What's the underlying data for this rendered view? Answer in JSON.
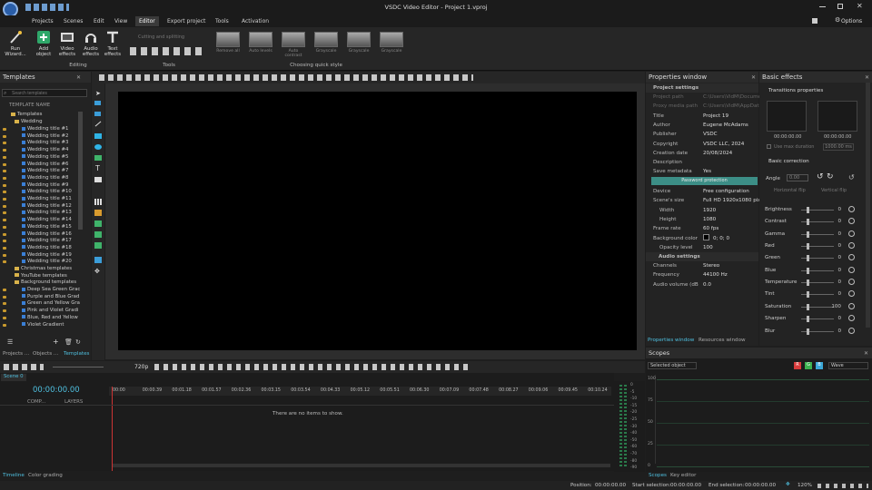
{
  "window": {
    "title": "VSDC Video Editor - Project 1.vproj",
    "options_label": "Options"
  },
  "menu": [
    {
      "label": "Projects"
    },
    {
      "label": "Scenes"
    },
    {
      "label": "Edit"
    },
    {
      "label": "View"
    },
    {
      "label": "Editor",
      "active": true
    },
    {
      "label": "Export project"
    },
    {
      "label": "Tools"
    },
    {
      "label": "Activation"
    }
  ],
  "ribbon": {
    "run_wizard": "Run Wizard...",
    "add_object": "Add object",
    "video_effects": "Video effects",
    "audio_effects": "Audio effects",
    "text_effects": "Text effects",
    "editing_label": "Editing",
    "cutting_label": "Cutting and splitting",
    "tools_label": "Tools",
    "quick_style_label": "Choosing quick style",
    "quick_styles": [
      "Remove all",
      "Auto levels",
      "Auto contrast",
      "Grayscale",
      "Grayscale",
      "Grayscale"
    ]
  },
  "templates": {
    "title": "Templates",
    "search_placeholder": "Search templates",
    "column_header": "TEMPLATE NAME",
    "root": "Templates",
    "wedding_group": "Wedding",
    "wedding_items": [
      "Wedding title #1",
      "Wedding title #2",
      "Wedding title #3",
      "Wedding title #4",
      "Wedding title #5",
      "Wedding title #6",
      "Wedding title #7",
      "Wedding title #8",
      "Wedding title #9",
      "Wedding title #10",
      "Wedding title #11",
      "Wedding title #12",
      "Wedding title #13",
      "Wedding title #14",
      "Wedding title #15",
      "Wedding title #16",
      "Wedding title #17",
      "Wedding title #18",
      "Wedding title #19",
      "Wedding title #20"
    ],
    "groups": [
      "Christmas templates",
      "YouTube templates",
      "Background templates"
    ],
    "background_items": [
      "Deep Sea Green Grac",
      "Purple and Blue Grad",
      "Green and Yellow Gra",
      "Pink and Violet Gradi",
      "Blue, Red and Yellow",
      "Violet Gradient"
    ],
    "bottom_tabs": [
      "Projects ...",
      "Objects ...",
      "Templates"
    ]
  },
  "properties": {
    "title": "Properties window",
    "project_settings": "Project settings",
    "rows": [
      {
        "k": "Project path",
        "v": "C:\\Users\\VidM\\Docume",
        "dim": true
      },
      {
        "k": "Proxy media path",
        "v": "C:\\Users\\VidM\\AppDat",
        "dim": true
      },
      {
        "k": "Title",
        "v": "Project 19"
      },
      {
        "k": "Author",
        "v": "Eugene McAdams"
      },
      {
        "k": "Publisher",
        "v": "VSDC"
      },
      {
        "k": "Copyright",
        "v": "VSDC LLC, 2024"
      },
      {
        "k": "Creation date",
        "v": "20/08/2024"
      },
      {
        "k": "Description",
        "v": ""
      },
      {
        "k": "Save metadata",
        "v": "Yes"
      }
    ],
    "password_button": "Password protection",
    "rows2": [
      {
        "k": "Device",
        "v": "Free configuration"
      },
      {
        "k": "Scene's size",
        "v": "Full HD 1920x1080 pix"
      },
      {
        "k": "Width",
        "v": "1920",
        "indent": true
      },
      {
        "k": "Height",
        "v": "1080",
        "indent": true
      },
      {
        "k": "Frame rate",
        "v": "60 fps"
      },
      {
        "k": "Background color",
        "v": "0; 0; 0"
      },
      {
        "k": "Opacity level",
        "v": "100",
        "indent": true
      }
    ],
    "audio_settings": "Audio settings",
    "audio_rows": [
      {
        "k": "Channels",
        "v": "Stereo"
      },
      {
        "k": "Frequency",
        "v": "44100 Hz"
      },
      {
        "k": "Audio volume (dB",
        "v": "0.0"
      }
    ],
    "bottom_tabs": [
      "Properties window",
      "Resources window"
    ]
  },
  "basic_effects": {
    "title": "Basic effects",
    "transitions": "Transitions properties",
    "time_left": "00:00:00.00",
    "time_right": "00:00:00.00",
    "use_max_duration": "Use max duration",
    "duration_value": "1000.00 ms",
    "basic_correction": "Basic correction",
    "angle_label": "Angle",
    "angle_value": "0.00",
    "horizontal_flip": "Horizontal flip",
    "vertical_flip": "Vertical flip",
    "sliders": [
      {
        "label": "Brightness",
        "value": "0"
      },
      {
        "label": "Contrast",
        "value": "0"
      },
      {
        "label": "Gamma",
        "value": "0"
      },
      {
        "label": "Red",
        "value": "0"
      },
      {
        "label": "Green",
        "value": "0"
      },
      {
        "label": "Blue",
        "value": "0"
      },
      {
        "label": "Temperature",
        "value": "0"
      },
      {
        "label": "Tint",
        "value": "0"
      },
      {
        "label": "Saturation",
        "value": "100"
      },
      {
        "label": "Sharpen",
        "value": "0"
      },
      {
        "label": "Blur",
        "value": "0"
      }
    ]
  },
  "playback": {
    "quality": "720p"
  },
  "timeline": {
    "scene_tab": "Scene 0",
    "current_time": "00:00:00.00",
    "col_comp": "COMP...",
    "col_layers": "LAYERS",
    "ruler": [
      "00:00",
      "00:00.39",
      "00:01.18",
      "00:01.57",
      "00:02.36",
      "00:03.15",
      "00:03.54",
      "00:04.33",
      "00:05.12",
      "00:05.51",
      "00:06.30",
      "00:07.09",
      "00:07.48",
      "00:08.27",
      "00:09.06",
      "00:09.45",
      "00:10.24"
    ],
    "empty_message": "There are no items to show.",
    "meter_labels": [
      "0",
      "-5",
      "-10",
      "-15",
      "-20",
      "-25",
      "-30",
      "-40",
      "-50",
      "-60",
      "-70",
      "-80",
      "-90"
    ],
    "bottom_tabs": [
      "Timeline",
      "Color grading"
    ]
  },
  "scopes": {
    "title": "Scopes",
    "selected": "Selected object",
    "mode": "Wave",
    "channels": [
      "R",
      "G",
      "B"
    ],
    "axis": [
      "100",
      "75",
      "50",
      "25",
      "0"
    ],
    "bottom_tabs": [
      "Scopes",
      "Key editor"
    ]
  },
  "status": {
    "position": "Position:",
    "position_val": "00:00:00.00",
    "start_sel": "Start selection:",
    "start_val": "00:00:00.00",
    "end_sel": "End selection:",
    "end_val": "00:00:00.00",
    "zoom": "120%"
  },
  "colors": {
    "accent": "#4fc0e0",
    "password_btn": "#3c8e86",
    "bg": "#1e1e1e"
  }
}
